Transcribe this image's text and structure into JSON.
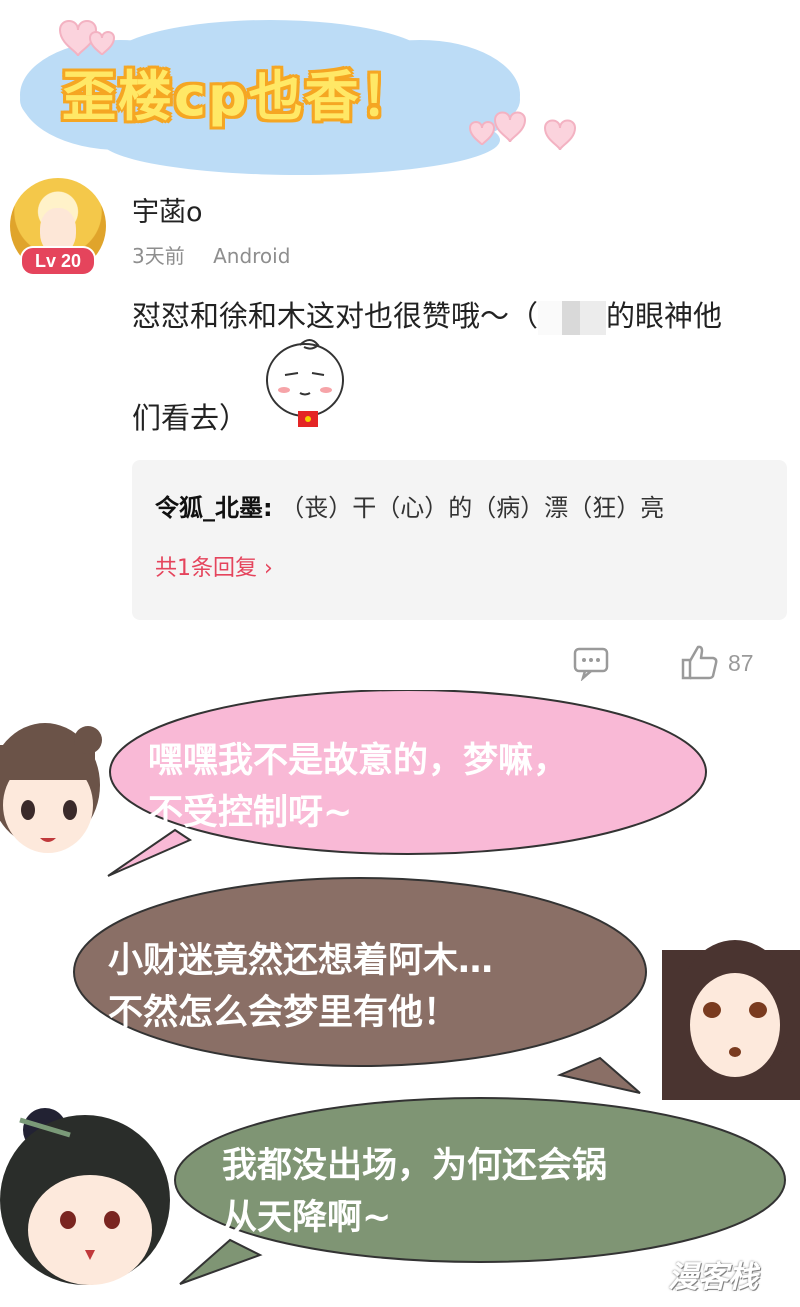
{
  "banner": {
    "title": "歪楼cp也香！"
  },
  "comment": {
    "username": "宇菡o",
    "level": "Lv 20",
    "time": "3天前",
    "device": "Android",
    "text_part1": "怼怼和徐和木这对也很赞哦～（",
    "text_part2": "的眼神他",
    "text_line2": "们看去）",
    "reply": {
      "author": "令狐_北墨:",
      "text": "（丧）干（心）的（病）漂（狂）亮",
      "count_label": "共1条回复 ›"
    },
    "like_count": "87"
  },
  "bubbles": {
    "pink": {
      "line1": "嘿嘿我不是故意的，梦嘛，",
      "line2": "不受控制呀~",
      "color": "#f9b9d6"
    },
    "brown": {
      "line1": "小财迷竟然还想着阿木…",
      "line2": "不然怎么会梦里有他！",
      "color": "#8a6f66"
    },
    "green": {
      "line1": "我都没出场，为何还会锅",
      "line2": "从天降啊~",
      "color": "#7f9574"
    }
  },
  "watermark": "漫客栈"
}
